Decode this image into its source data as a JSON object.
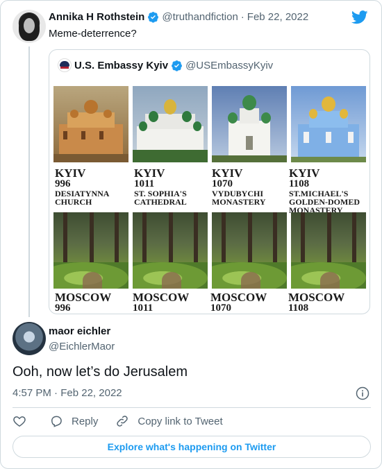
{
  "colors": {
    "accent": "#1d9bf0",
    "text": "#0f1419",
    "muted": "#536471",
    "border": "#cfd9de"
  },
  "tweet": {
    "author_name": "Annika H Rothstein",
    "author_handle": "@truthandfiction",
    "separator": "·",
    "date": "Feb 22, 2022",
    "text": "Meme-deterrence?",
    "verified": true,
    "logo_icon": "twitter-bird-icon"
  },
  "quoted_tweet": {
    "author_name": "U.S. Embassy Kyiv",
    "author_handle": "@USEmbassyKyiv",
    "verified": true,
    "image": {
      "kyiv": [
        {
          "city": "KYIV",
          "year": "996",
          "place": [
            "DESIATYNNA",
            "CHURCH"
          ]
        },
        {
          "city": "KYIV",
          "year": "1011",
          "place": [
            "ST. SOPHIA'S",
            "CATHEDRAL"
          ]
        },
        {
          "city": "KYIV",
          "year": "1070",
          "place": [
            "VYDUBYCHI",
            "MONASTERY"
          ]
        },
        {
          "city": "KYIV",
          "year": "1108",
          "place": [
            "ST.MICHAEL'S",
            "GOLDEN-DOMED",
            "MONASTERY"
          ]
        }
      ],
      "moscow": [
        {
          "city": "MOSCOW",
          "year": "996"
        },
        {
          "city": "MOSCOW",
          "year": "1011"
        },
        {
          "city": "MOSCOW",
          "year": "1070"
        },
        {
          "city": "MOSCOW",
          "year": "1108"
        }
      ]
    }
  },
  "reply": {
    "author_name": "maor eichler",
    "author_handle": "@EichlerMaor",
    "text": "Ooh, now let’s do Jerusalem",
    "time": "4:57 PM",
    "separator": "·",
    "date": "Feb 22, 2022"
  },
  "actions": {
    "like_icon": "heart-icon",
    "reply_label": "Reply",
    "copy_link_label": "Copy link to Tweet"
  },
  "explore_label": "Explore what's happening on Twitter"
}
